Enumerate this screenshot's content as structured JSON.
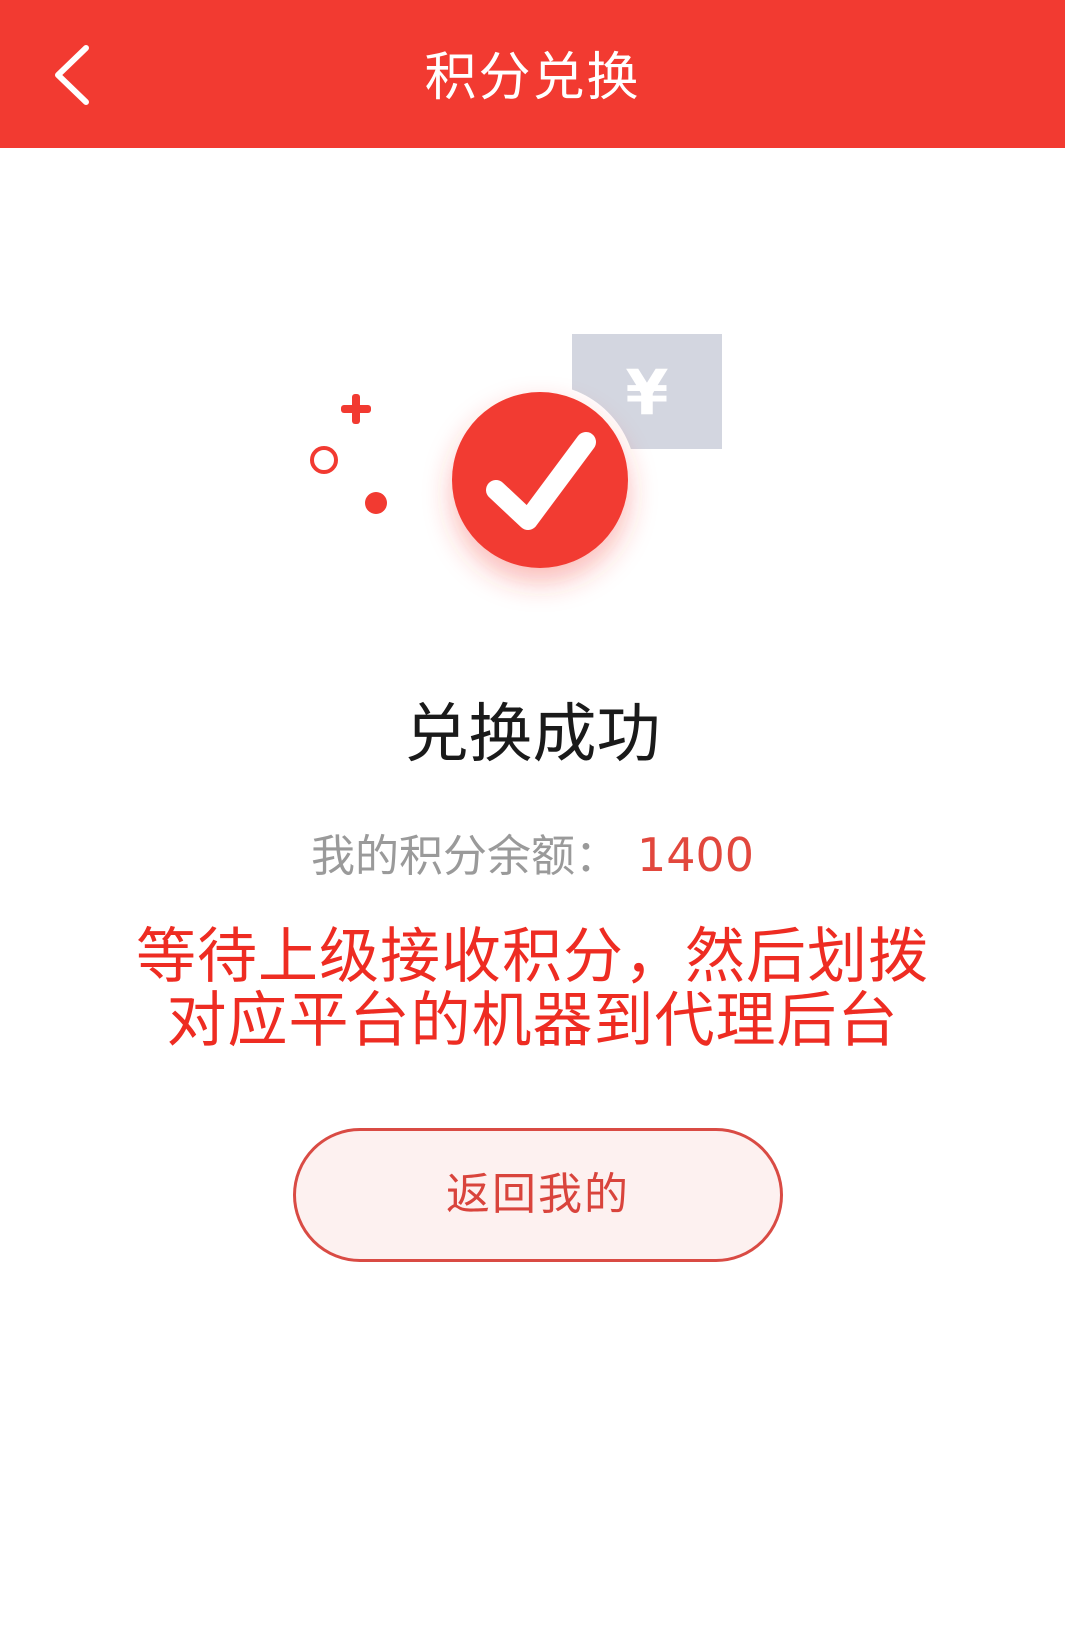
{
  "navbar": {
    "title": "积分兑换",
    "back_icon": "chevron-left-icon"
  },
  "illustration": {
    "currency_symbol": "¥",
    "icons": [
      "plus-icon",
      "ring-icon",
      "dot-icon",
      "yen-card-icon",
      "checkmark-badge-icon"
    ],
    "accent_color": "#f23a31",
    "card_color": "#d3d6e0"
  },
  "result": {
    "title": "兑换成功"
  },
  "balance": {
    "label": "我的积分余额：",
    "value": "1400"
  },
  "notice": {
    "line1": "等待上级接收积分，然后划拨",
    "line2": "对应平台的机器到代理后台"
  },
  "actions": {
    "return_label": "返回我的"
  },
  "colors": {
    "primary": "#f23a31",
    "notice_text": "#ee2c22",
    "button_bg": "#fdf1f0",
    "button_border": "#d94b44"
  }
}
